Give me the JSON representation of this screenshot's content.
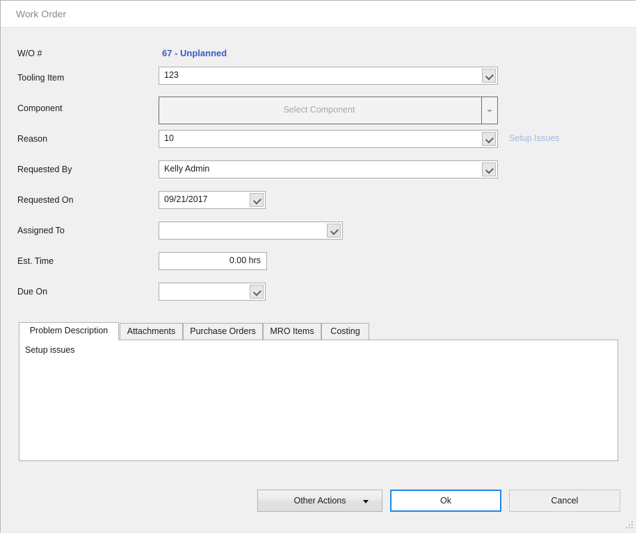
{
  "window": {
    "title": "Work Order"
  },
  "form": {
    "fields": [
      {
        "label": "W/O #",
        "value": "67 - Unplanned"
      },
      {
        "label": "Tooling Item",
        "value": "123"
      },
      {
        "label": "Component",
        "value": "",
        "placeholder": "Select Component"
      },
      {
        "label": "Reason",
        "value": "10"
      },
      {
        "label": "Requested By",
        "value": "Kelly Admin"
      },
      {
        "label": "Requested On",
        "value": "09/21/2017"
      },
      {
        "label": "Assigned To",
        "value": ""
      },
      {
        "label": "Est. Time",
        "value": "0.00 hrs"
      },
      {
        "label": "Due On",
        "value": ""
      }
    ],
    "setup_issues_link": "Setup Issues"
  },
  "tabs": [
    {
      "label": "Problem Description",
      "active": true
    },
    {
      "label": "Attachments",
      "active": false
    },
    {
      "label": "Purchase Orders",
      "active": false
    },
    {
      "label": "MRO Items",
      "active": false
    },
    {
      "label": "Costing",
      "active": false
    }
  ],
  "problem_description": {
    "text": "Setup issues"
  },
  "footer": {
    "other_actions_label": "Other Actions",
    "ok_label": "Ok",
    "cancel_label": "Cancel"
  },
  "colors": {
    "accent_blue": "#3b5bc4",
    "focus_blue": "#1f87e8",
    "link_blue": "#9dbbe0",
    "window_bg": "#f0f0f0"
  }
}
